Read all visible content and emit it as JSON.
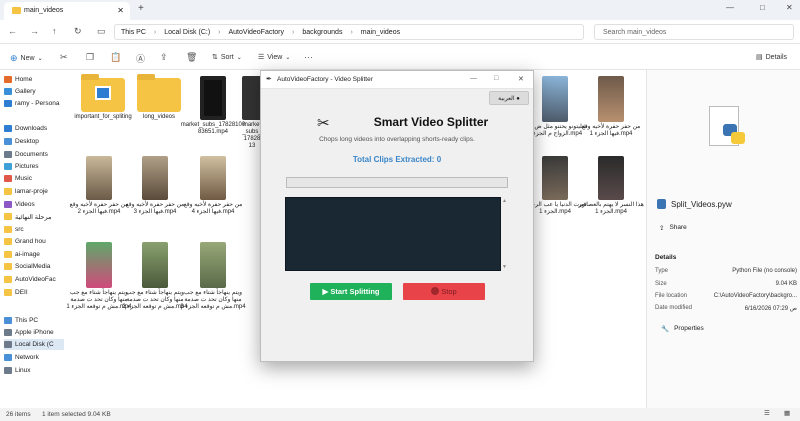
{
  "explorer": {
    "tab_title": "main_videos",
    "breadcrumbs": [
      "This PC",
      "Local Disk (C:)",
      "AutoVideoFactory",
      "backgrounds",
      "main_videos"
    ],
    "search_placeholder": "Search main_videos",
    "toolbar": {
      "new": "New",
      "sort": "Sort",
      "view": "View",
      "details": "Details"
    },
    "sidebar": [
      {
        "label": "Home",
        "color": "#e36c2a"
      },
      {
        "label": "Gallery",
        "color": "#3a8fd9"
      },
      {
        "label": "ramy - Persona",
        "color": "#2d7dd2"
      },
      {
        "label": "Downloads",
        "color": "#2d7dd2"
      },
      {
        "label": "Desktop",
        "color": "#4a90d9"
      },
      {
        "label": "Documents",
        "color": "#6c7a89"
      },
      {
        "label": "Pictures",
        "color": "#3fa0d8"
      },
      {
        "label": "Music",
        "color": "#e0584a"
      },
      {
        "label": "lamar-proje",
        "color": "#f5c445"
      },
      {
        "label": "Videos",
        "color": "#8e57c6"
      },
      {
        "label": "مرحلة النهائية",
        "color": "#f5c445"
      },
      {
        "label": "src",
        "color": "#f5c445"
      },
      {
        "label": "Grand hou",
        "color": "#f5c445"
      },
      {
        "label": "ai-image",
        "color": "#f5c445"
      },
      {
        "label": "SocialMedia",
        "color": "#f5c445"
      },
      {
        "label": "AutoVideoFac",
        "color": "#f5c445"
      },
      {
        "label": "DEII",
        "color": "#f5c445"
      },
      {
        "label": "This PC",
        "color": "#4a90d9"
      },
      {
        "label": "Apple iPhone",
        "color": "#6c7a89"
      },
      {
        "label": "Local Disk (C",
        "color": "#6c7a89"
      },
      {
        "label": "Network",
        "color": "#4a90d9"
      },
      {
        "label": "Linux",
        "color": "#6c7a89"
      }
    ],
    "files_row1": [
      {
        "name": "important_for_spliting",
        "kind": "folder-doc"
      },
      {
        "name": "long_videos",
        "kind": "folder"
      },
      {
        "name": "market_subs_1782810083651.mp4",
        "kind": "video"
      },
      {
        "name": "market_subs_1782813",
        "kind": "video"
      }
    ],
    "files_row1_right": [
      {
        "name": "شليتونو يحتنو مثل ض يريد الزواج م الجزء 1.mp4"
      },
      {
        "name": "من حفر حفرة لأخيه وقع فيها الجزء 1.mp4"
      }
    ],
    "files_row2": [
      {
        "name": "من حفر حفرة لأخيه وقع فيها الجزء 2.mp4"
      },
      {
        "name": "من حفر حفرة لأخيه وقع فيها الجزء 3.mp4"
      },
      {
        "name": "من حفر حفرة لأخيه وقع فيها الجزء 4.mp4"
      }
    ],
    "files_row2_right": [
      {
        "name": "ثورت الدنيا يا عب الرحمن الجزء 1.mp4"
      },
      {
        "name": "هذا النسر لا يهتم بالعصافير الجزء 1.mp4"
      }
    ],
    "files_row3": [
      {
        "name": "ويتم ينهاجأ شتاء مع جب منها وكان تحد ت صدمة مش م توقعه الجزء 1.mp4"
      },
      {
        "name": "ويتم ينهاجأ شتاء مع جب منها وكان تحد ت صدمة مش م توقعه الجزء 2.mp4"
      },
      {
        "name": "ويتم ينهاجأ شتاء مع جب منها وكان تحد ت صدمة مش م توقعه الجزء 3.mp4"
      }
    ],
    "details_pane": {
      "file_name": "Split_Videos.pyw",
      "share": "Share",
      "section": "Details",
      "rows": [
        {
          "k": "Type",
          "v": "Python File (no console)"
        },
        {
          "k": "Size",
          "v": "9.04 KB"
        },
        {
          "k": "File location",
          "v": "C:\\AutoVideoFactory\\backgro..."
        },
        {
          "k": "Date modified",
          "v": "6/16/2026 07:29 ص"
        }
      ],
      "properties": "Properties"
    },
    "status": {
      "items": "26 items",
      "selected": "1 item selected  9.04 KB"
    }
  },
  "app": {
    "window_title": "AutoVideoFactory - Video Splitter",
    "lang_button": "العربية ●",
    "heading": "Smart Video Splitter",
    "subtitle": "Chops long videos into overlapping shorts-ready clips.",
    "clip_count": "Total Clips Extracted: 0",
    "progress": 0,
    "start_label": "▶ Start Splitting",
    "stop_label": "Stop",
    "colors": {
      "start": "#1fb25a",
      "stop": "#e84349",
      "count": "#3a86c8",
      "log_bg": "#1a2833"
    }
  }
}
